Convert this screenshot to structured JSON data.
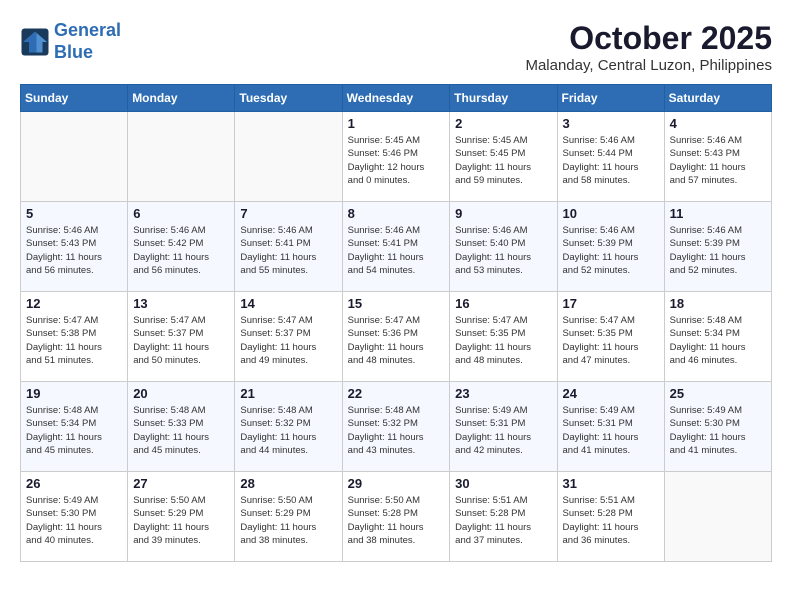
{
  "header": {
    "logo_line1": "General",
    "logo_line2": "Blue",
    "month": "October 2025",
    "location": "Malanday, Central Luzon, Philippines"
  },
  "days_of_week": [
    "Sunday",
    "Monday",
    "Tuesday",
    "Wednesday",
    "Thursday",
    "Friday",
    "Saturday"
  ],
  "weeks": [
    [
      {
        "day": "",
        "info": ""
      },
      {
        "day": "",
        "info": ""
      },
      {
        "day": "",
        "info": ""
      },
      {
        "day": "1",
        "info": "Sunrise: 5:45 AM\nSunset: 5:46 PM\nDaylight: 12 hours\nand 0 minutes."
      },
      {
        "day": "2",
        "info": "Sunrise: 5:45 AM\nSunset: 5:45 PM\nDaylight: 11 hours\nand 59 minutes."
      },
      {
        "day": "3",
        "info": "Sunrise: 5:46 AM\nSunset: 5:44 PM\nDaylight: 11 hours\nand 58 minutes."
      },
      {
        "day": "4",
        "info": "Sunrise: 5:46 AM\nSunset: 5:43 PM\nDaylight: 11 hours\nand 57 minutes."
      }
    ],
    [
      {
        "day": "5",
        "info": "Sunrise: 5:46 AM\nSunset: 5:43 PM\nDaylight: 11 hours\nand 56 minutes."
      },
      {
        "day": "6",
        "info": "Sunrise: 5:46 AM\nSunset: 5:42 PM\nDaylight: 11 hours\nand 56 minutes."
      },
      {
        "day": "7",
        "info": "Sunrise: 5:46 AM\nSunset: 5:41 PM\nDaylight: 11 hours\nand 55 minutes."
      },
      {
        "day": "8",
        "info": "Sunrise: 5:46 AM\nSunset: 5:41 PM\nDaylight: 11 hours\nand 54 minutes."
      },
      {
        "day": "9",
        "info": "Sunrise: 5:46 AM\nSunset: 5:40 PM\nDaylight: 11 hours\nand 53 minutes."
      },
      {
        "day": "10",
        "info": "Sunrise: 5:46 AM\nSunset: 5:39 PM\nDaylight: 11 hours\nand 52 minutes."
      },
      {
        "day": "11",
        "info": "Sunrise: 5:46 AM\nSunset: 5:39 PM\nDaylight: 11 hours\nand 52 minutes."
      }
    ],
    [
      {
        "day": "12",
        "info": "Sunrise: 5:47 AM\nSunset: 5:38 PM\nDaylight: 11 hours\nand 51 minutes."
      },
      {
        "day": "13",
        "info": "Sunrise: 5:47 AM\nSunset: 5:37 PM\nDaylight: 11 hours\nand 50 minutes."
      },
      {
        "day": "14",
        "info": "Sunrise: 5:47 AM\nSunset: 5:37 PM\nDaylight: 11 hours\nand 49 minutes."
      },
      {
        "day": "15",
        "info": "Sunrise: 5:47 AM\nSunset: 5:36 PM\nDaylight: 11 hours\nand 48 minutes."
      },
      {
        "day": "16",
        "info": "Sunrise: 5:47 AM\nSunset: 5:35 PM\nDaylight: 11 hours\nand 48 minutes."
      },
      {
        "day": "17",
        "info": "Sunrise: 5:47 AM\nSunset: 5:35 PM\nDaylight: 11 hours\nand 47 minutes."
      },
      {
        "day": "18",
        "info": "Sunrise: 5:48 AM\nSunset: 5:34 PM\nDaylight: 11 hours\nand 46 minutes."
      }
    ],
    [
      {
        "day": "19",
        "info": "Sunrise: 5:48 AM\nSunset: 5:34 PM\nDaylight: 11 hours\nand 45 minutes."
      },
      {
        "day": "20",
        "info": "Sunrise: 5:48 AM\nSunset: 5:33 PM\nDaylight: 11 hours\nand 45 minutes."
      },
      {
        "day": "21",
        "info": "Sunrise: 5:48 AM\nSunset: 5:32 PM\nDaylight: 11 hours\nand 44 minutes."
      },
      {
        "day": "22",
        "info": "Sunrise: 5:48 AM\nSunset: 5:32 PM\nDaylight: 11 hours\nand 43 minutes."
      },
      {
        "day": "23",
        "info": "Sunrise: 5:49 AM\nSunset: 5:31 PM\nDaylight: 11 hours\nand 42 minutes."
      },
      {
        "day": "24",
        "info": "Sunrise: 5:49 AM\nSunset: 5:31 PM\nDaylight: 11 hours\nand 41 minutes."
      },
      {
        "day": "25",
        "info": "Sunrise: 5:49 AM\nSunset: 5:30 PM\nDaylight: 11 hours\nand 41 minutes."
      }
    ],
    [
      {
        "day": "26",
        "info": "Sunrise: 5:49 AM\nSunset: 5:30 PM\nDaylight: 11 hours\nand 40 minutes."
      },
      {
        "day": "27",
        "info": "Sunrise: 5:50 AM\nSunset: 5:29 PM\nDaylight: 11 hours\nand 39 minutes."
      },
      {
        "day": "28",
        "info": "Sunrise: 5:50 AM\nSunset: 5:29 PM\nDaylight: 11 hours\nand 38 minutes."
      },
      {
        "day": "29",
        "info": "Sunrise: 5:50 AM\nSunset: 5:28 PM\nDaylight: 11 hours\nand 38 minutes."
      },
      {
        "day": "30",
        "info": "Sunrise: 5:51 AM\nSunset: 5:28 PM\nDaylight: 11 hours\nand 37 minutes."
      },
      {
        "day": "31",
        "info": "Sunrise: 5:51 AM\nSunset: 5:28 PM\nDaylight: 11 hours\nand 36 minutes."
      },
      {
        "day": "",
        "info": ""
      }
    ]
  ]
}
